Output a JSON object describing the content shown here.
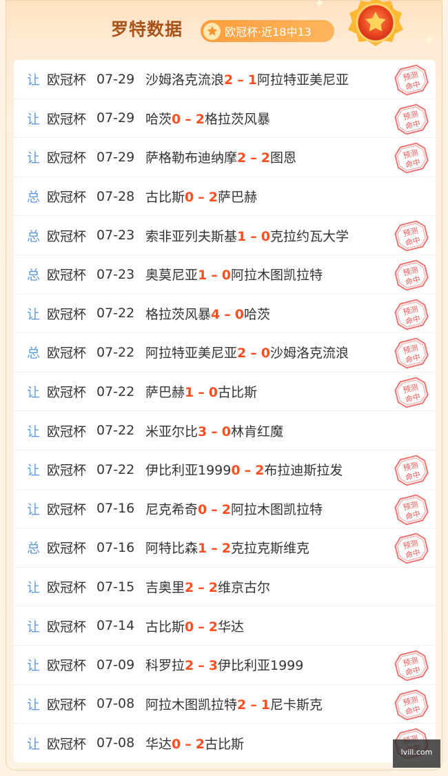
{
  "header": {
    "title": "罗特数据",
    "badge_text": "欧冠杯·近18中13"
  },
  "colors": {
    "accent": "#ff9d3d",
    "score": "#ff4d1f",
    "type_blue": "#5c9be5",
    "stamp_red": "#ef5a56"
  },
  "stamp_text": "预测命中",
  "watermark": {
    "domain": "lvill.com"
  },
  "rows": [
    {
      "type": "让",
      "league": "欧冠杯",
      "date": "07-29",
      "home": "沙姆洛克流浪",
      "home_score": "2",
      "away_score": "1",
      "away": "阿拉特亚美尼亚",
      "hit": true
    },
    {
      "type": "让",
      "league": "欧冠杯",
      "date": "07-29",
      "home": "哈茨",
      "home_score": "0",
      "away_score": "2",
      "away": "格拉茨风暴",
      "hit": true
    },
    {
      "type": "让",
      "league": "欧冠杯",
      "date": "07-29",
      "home": "萨格勒布迪纳摩",
      "home_score": "2",
      "away_score": "2",
      "away": "图恩",
      "hit": true
    },
    {
      "type": "总",
      "league": "欧冠杯",
      "date": "07-28",
      "home": "古比斯",
      "home_score": "0",
      "away_score": "2",
      "away": "萨巴赫",
      "hit": false
    },
    {
      "type": "总",
      "league": "欧冠杯",
      "date": "07-23",
      "home": "索非亚列夫斯基",
      "home_score": "1",
      "away_score": "0",
      "away": "克拉约瓦大学",
      "hit": true
    },
    {
      "type": "总",
      "league": "欧冠杯",
      "date": "07-23",
      "home": "奥莫尼亚",
      "home_score": "1",
      "away_score": "0",
      "away": "阿拉木图凯拉特",
      "hit": true
    },
    {
      "type": "让",
      "league": "欧冠杯",
      "date": "07-22",
      "home": "格拉茨风暴",
      "home_score": "4",
      "away_score": "0",
      "away": "哈茨",
      "hit": true
    },
    {
      "type": "总",
      "league": "欧冠杯",
      "date": "07-22",
      "home": "阿拉特亚美尼亚",
      "home_score": "2",
      "away_score": "0",
      "away": "沙姆洛克流浪",
      "hit": true
    },
    {
      "type": "让",
      "league": "欧冠杯",
      "date": "07-22",
      "home": "萨巴赫",
      "home_score": "1",
      "away_score": "0",
      "away": "古比斯",
      "hit": true
    },
    {
      "type": "让",
      "league": "欧冠杯",
      "date": "07-22",
      "home": "米亚尔比",
      "home_score": "3",
      "away_score": "0",
      "away": "林肯红魔",
      "hit": false
    },
    {
      "type": "让",
      "league": "欧冠杯",
      "date": "07-22",
      "home": "伊比利亚1999",
      "home_score": "0",
      "away_score": "2",
      "away": "布拉迪斯拉发",
      "hit": true
    },
    {
      "type": "让",
      "league": "欧冠杯",
      "date": "07-16",
      "home": "尼克希奇",
      "home_score": "0",
      "away_score": "2",
      "away": "阿拉木图凯拉特",
      "hit": true
    },
    {
      "type": "总",
      "league": "欧冠杯",
      "date": "07-16",
      "home": "阿特比森",
      "home_score": "1",
      "away_score": "2",
      "away": "克拉克斯维克",
      "hit": true
    },
    {
      "type": "让",
      "league": "欧冠杯",
      "date": "07-15",
      "home": "吉奥里",
      "home_score": "2",
      "away_score": "2",
      "away": "维京古尔",
      "hit": false
    },
    {
      "type": "让",
      "league": "欧冠杯",
      "date": "07-14",
      "home": "古比斯",
      "home_score": "0",
      "away_score": "2",
      "away": "华达",
      "hit": false
    },
    {
      "type": "让",
      "league": "欧冠杯",
      "date": "07-09",
      "home": "科罗拉",
      "home_score": "2",
      "away_score": "3",
      "away": "伊比利亚1999",
      "hit": true
    },
    {
      "type": "让",
      "league": "欧冠杯",
      "date": "07-08",
      "home": "阿拉木图凯拉特",
      "home_score": "2",
      "away_score": "1",
      "away": "尼卡斯克",
      "hit": true
    },
    {
      "type": "让",
      "league": "欧冠杯",
      "date": "07-08",
      "home": "华达",
      "home_score": "0",
      "away_score": "2",
      "away": "古比斯",
      "hit": true
    }
  ]
}
